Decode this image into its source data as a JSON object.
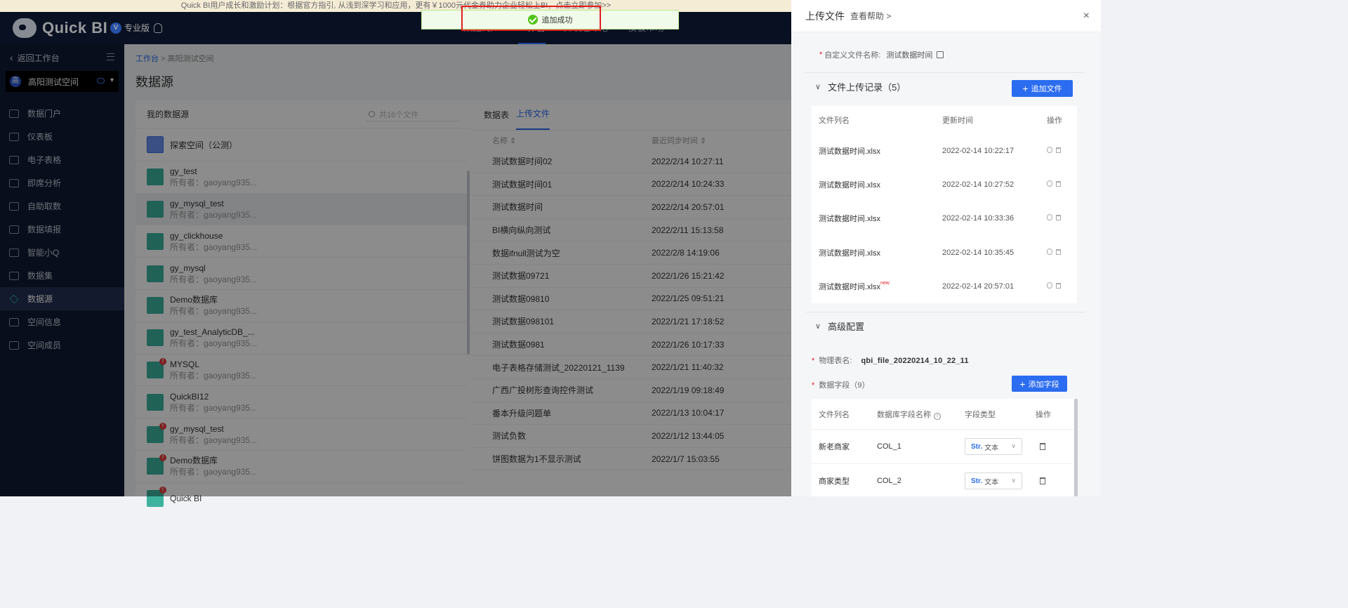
{
  "announcement": "Quick BI用户成长和激励计划：根据官方指引, 从浅到深学习和应用，更有￥1000元代金券助力企业轻松上BI，点击立即参加>>",
  "header": {
    "logo_text": "Quick BI",
    "edition": "专业版",
    "edition_badge": "V",
    "nav": [
      "数据门户",
      "工作台",
      "开发者中心",
      "模板市场"
    ]
  },
  "toast": {
    "text": "追加成功"
  },
  "sidebar": {
    "back_label": "返回工作台",
    "space_avatar": "高",
    "space_name": "高阳测试空间",
    "items": [
      {
        "label": "数据门户",
        "icon": "portal-icon"
      },
      {
        "label": "仪表板",
        "icon": "dashboard-icon"
      },
      {
        "label": "电子表格",
        "icon": "spreadsheet-icon"
      },
      {
        "label": "即席分析",
        "icon": "adhoc-icon"
      },
      {
        "label": "自助取数",
        "icon": "self-fetch-icon"
      },
      {
        "label": "数据填报",
        "icon": "form-icon"
      },
      {
        "label": "智能小Q",
        "icon": "chat-icon"
      },
      {
        "label": "数据集",
        "icon": "dataset-icon"
      },
      {
        "label": "数据源",
        "icon": "datasource-icon"
      },
      {
        "label": "空间信息",
        "icon": "info-icon"
      },
      {
        "label": "空间成员",
        "icon": "members-icon"
      }
    ]
  },
  "main": {
    "breadcrumb": [
      "工作台",
      "高阳测试空间"
    ],
    "title": "数据源",
    "left": {
      "heading": "我的数据源",
      "search_placeholder": "共16个文件",
      "explore": "探索空间（公测）",
      "items": [
        {
          "name": "gy_test",
          "owner": "所有者：gaoyang935..."
        },
        {
          "name": "gy_mysql_test",
          "owner": "所有者：gaoyang935..."
        },
        {
          "name": "gy_clickhouse",
          "owner": "所有者：gaoyang935..."
        },
        {
          "name": "gy_mysql",
          "owner": "所有者：gaoyang935..."
        },
        {
          "name": "Demo数据库",
          "owner": "所有者：gaoyang935..."
        },
        {
          "name": "gy_test_AnalyticDB_...",
          "owner": "所有者：gaoyang935..."
        },
        {
          "name": "MYSQL",
          "owner": "所有者：gaoyang935..."
        },
        {
          "name": "QuickBI12",
          "owner": "所有者：gaoyang935..."
        },
        {
          "name": "gy_mysql_test",
          "owner": "所有者：gaoyang935..."
        },
        {
          "name": "Demo数据库",
          "owner": "所有者：gaoyang935..."
        },
        {
          "name": "Quick BI",
          "owner": ""
        }
      ]
    },
    "right": {
      "tabs": [
        "数据表",
        "上传文件"
      ],
      "col_name": "名称 ⇕",
      "col_time": "最近同步时间 ⇕",
      "files": [
        {
          "name": "测试数据时间02",
          "time": "2022/2/14 10:27:11"
        },
        {
          "name": "测试数据时间01",
          "time": "2022/2/14 10:24:33"
        },
        {
          "name": "测试数据时间",
          "time": "2022/2/14 20:57:01"
        },
        {
          "name": "BI横向纵向测试",
          "time": "2022/2/11 15:13:58"
        },
        {
          "name": "数据ifnull测试为空",
          "time": "2022/2/8 14:19:06"
        },
        {
          "name": "测试数据09721",
          "time": "2022/1/26 15:21:42"
        },
        {
          "name": "测试数据09810",
          "time": "2022/1/25 09:51:21"
        },
        {
          "name": "测试数据098101",
          "time": "2022/1/21 17:18:52"
        },
        {
          "name": "测试数据0981",
          "time": "2022/1/26 10:17:33"
        },
        {
          "name": "电子表格存储测试_20220121_1139",
          "time": "2022/1/21 11:40:32"
        },
        {
          "name": "广西广投树形查询控件测试",
          "time": "2022/1/19 09:18:49"
        },
        {
          "name": "番本升级问题单",
          "time": "2022/1/13 10:04:17"
        },
        {
          "name": "测试负数",
          "time": "2022/1/12 13:44:05"
        },
        {
          "name": "饼图数据为1不显示测试",
          "time": "2022/1/7 15:03:55"
        }
      ]
    }
  },
  "drawer": {
    "title": "上传文件",
    "help": "查看帮助 >",
    "close": "×",
    "file_name_label": "自定义文件名称:",
    "file_name_value": "测试数据时间",
    "records_title": "文件上传记录（5）",
    "add_file_label": "追加文件",
    "records_cols": [
      "文件列名",
      "更新时间",
      "操作"
    ],
    "records": [
      {
        "name": "测试数据时间.xlsx",
        "time": "2022-02-14 10:22:17",
        "new": ""
      },
      {
        "name": "测试数据时间.xlsx",
        "time": "2022-02-14 10:27:52",
        "new": ""
      },
      {
        "name": "测试数据时间.xlsx",
        "time": "2022-02-14 10:33:36",
        "new": ""
      },
      {
        "name": "测试数据时间.xlsx",
        "time": "2022-02-14 10:35:45",
        "new": ""
      },
      {
        "name": "测试数据时间.xlsx",
        "time": "2022-02-14 20:57:01",
        "new": "new"
      }
    ],
    "advanced_title": "高级配置",
    "phys_label": "物理表名:",
    "phys_value": "qbi_file_20220214_10_22_11",
    "fields_label": "数据字段（9）",
    "add_field_label": "添加字段",
    "fields_cols": [
      "文件列名",
      "数据库字段名称",
      "字段类型",
      "操作"
    ],
    "fields": [
      {
        "col": "新老商家",
        "db": "COL_1",
        "type_tag": "Str.",
        "type": "文本"
      },
      {
        "col": "商家类型",
        "db": "COL_2",
        "type_tag": "Str.",
        "type": "文本"
      }
    ]
  }
}
